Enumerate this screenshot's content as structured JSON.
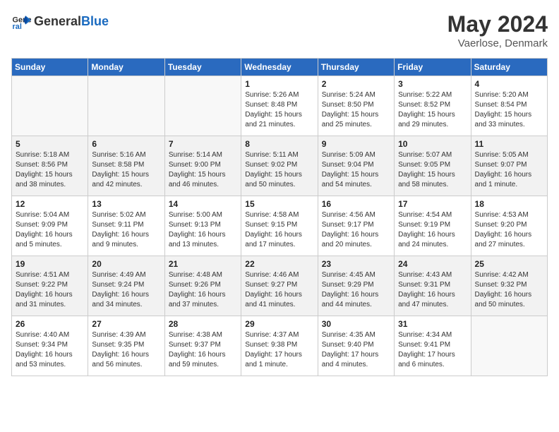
{
  "header": {
    "logo_general": "General",
    "logo_blue": "Blue",
    "month_year": "May 2024",
    "location": "Vaerlose, Denmark"
  },
  "days_of_week": [
    "Sunday",
    "Monday",
    "Tuesday",
    "Wednesday",
    "Thursday",
    "Friday",
    "Saturday"
  ],
  "weeks": [
    [
      {
        "day": "",
        "content": ""
      },
      {
        "day": "",
        "content": ""
      },
      {
        "day": "",
        "content": ""
      },
      {
        "day": "1",
        "content": "Sunrise: 5:26 AM\nSunset: 8:48 PM\nDaylight: 15 hours\nand 21 minutes."
      },
      {
        "day": "2",
        "content": "Sunrise: 5:24 AM\nSunset: 8:50 PM\nDaylight: 15 hours\nand 25 minutes."
      },
      {
        "day": "3",
        "content": "Sunrise: 5:22 AM\nSunset: 8:52 PM\nDaylight: 15 hours\nand 29 minutes."
      },
      {
        "day": "4",
        "content": "Sunrise: 5:20 AM\nSunset: 8:54 PM\nDaylight: 15 hours\nand 33 minutes."
      }
    ],
    [
      {
        "day": "5",
        "content": "Sunrise: 5:18 AM\nSunset: 8:56 PM\nDaylight: 15 hours\nand 38 minutes."
      },
      {
        "day": "6",
        "content": "Sunrise: 5:16 AM\nSunset: 8:58 PM\nDaylight: 15 hours\nand 42 minutes."
      },
      {
        "day": "7",
        "content": "Sunrise: 5:14 AM\nSunset: 9:00 PM\nDaylight: 15 hours\nand 46 minutes."
      },
      {
        "day": "8",
        "content": "Sunrise: 5:11 AM\nSunset: 9:02 PM\nDaylight: 15 hours\nand 50 minutes."
      },
      {
        "day": "9",
        "content": "Sunrise: 5:09 AM\nSunset: 9:04 PM\nDaylight: 15 hours\nand 54 minutes."
      },
      {
        "day": "10",
        "content": "Sunrise: 5:07 AM\nSunset: 9:05 PM\nDaylight: 15 hours\nand 58 minutes."
      },
      {
        "day": "11",
        "content": "Sunrise: 5:05 AM\nSunset: 9:07 PM\nDaylight: 16 hours\nand 1 minute."
      }
    ],
    [
      {
        "day": "12",
        "content": "Sunrise: 5:04 AM\nSunset: 9:09 PM\nDaylight: 16 hours\nand 5 minutes."
      },
      {
        "day": "13",
        "content": "Sunrise: 5:02 AM\nSunset: 9:11 PM\nDaylight: 16 hours\nand 9 minutes."
      },
      {
        "day": "14",
        "content": "Sunrise: 5:00 AM\nSunset: 9:13 PM\nDaylight: 16 hours\nand 13 minutes."
      },
      {
        "day": "15",
        "content": "Sunrise: 4:58 AM\nSunset: 9:15 PM\nDaylight: 16 hours\nand 17 minutes."
      },
      {
        "day": "16",
        "content": "Sunrise: 4:56 AM\nSunset: 9:17 PM\nDaylight: 16 hours\nand 20 minutes."
      },
      {
        "day": "17",
        "content": "Sunrise: 4:54 AM\nSunset: 9:19 PM\nDaylight: 16 hours\nand 24 minutes."
      },
      {
        "day": "18",
        "content": "Sunrise: 4:53 AM\nSunset: 9:20 PM\nDaylight: 16 hours\nand 27 minutes."
      }
    ],
    [
      {
        "day": "19",
        "content": "Sunrise: 4:51 AM\nSunset: 9:22 PM\nDaylight: 16 hours\nand 31 minutes."
      },
      {
        "day": "20",
        "content": "Sunrise: 4:49 AM\nSunset: 9:24 PM\nDaylight: 16 hours\nand 34 minutes."
      },
      {
        "day": "21",
        "content": "Sunrise: 4:48 AM\nSunset: 9:26 PM\nDaylight: 16 hours\nand 37 minutes."
      },
      {
        "day": "22",
        "content": "Sunrise: 4:46 AM\nSunset: 9:27 PM\nDaylight: 16 hours\nand 41 minutes."
      },
      {
        "day": "23",
        "content": "Sunrise: 4:45 AM\nSunset: 9:29 PM\nDaylight: 16 hours\nand 44 minutes."
      },
      {
        "day": "24",
        "content": "Sunrise: 4:43 AM\nSunset: 9:31 PM\nDaylight: 16 hours\nand 47 minutes."
      },
      {
        "day": "25",
        "content": "Sunrise: 4:42 AM\nSunset: 9:32 PM\nDaylight: 16 hours\nand 50 minutes."
      }
    ],
    [
      {
        "day": "26",
        "content": "Sunrise: 4:40 AM\nSunset: 9:34 PM\nDaylight: 16 hours\nand 53 minutes."
      },
      {
        "day": "27",
        "content": "Sunrise: 4:39 AM\nSunset: 9:35 PM\nDaylight: 16 hours\nand 56 minutes."
      },
      {
        "day": "28",
        "content": "Sunrise: 4:38 AM\nSunset: 9:37 PM\nDaylight: 16 hours\nand 59 minutes."
      },
      {
        "day": "29",
        "content": "Sunrise: 4:37 AM\nSunset: 9:38 PM\nDaylight: 17 hours\nand 1 minute."
      },
      {
        "day": "30",
        "content": "Sunrise: 4:35 AM\nSunset: 9:40 PM\nDaylight: 17 hours\nand 4 minutes."
      },
      {
        "day": "31",
        "content": "Sunrise: 4:34 AM\nSunset: 9:41 PM\nDaylight: 17 hours\nand 6 minutes."
      },
      {
        "day": "",
        "content": ""
      }
    ]
  ]
}
